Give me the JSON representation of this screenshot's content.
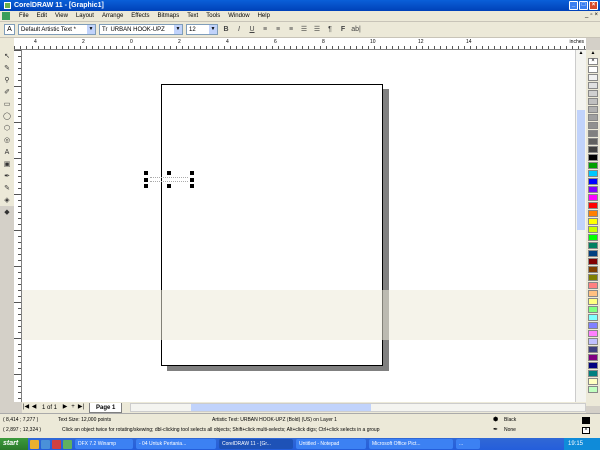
{
  "window": {
    "title": "CorelDRAW 11 - [Graphic1]"
  },
  "menu": [
    "File",
    "Edit",
    "View",
    "Layout",
    "Arrange",
    "Effects",
    "Bitmaps",
    "Text",
    "Tools",
    "Window",
    "Help"
  ],
  "propbar": {
    "style_value": "Default Artistic Text *",
    "font_value": "URBAN HOOK-UPZ",
    "size_value": "12",
    "bold": "B",
    "italic": "I",
    "underline": "U",
    "paragraph": "¶",
    "font_f": "F",
    "abl": "ab|"
  },
  "ruler": {
    "unit": "inches",
    "h_labels": [
      "4",
      "2",
      "0",
      "2",
      "4",
      "6",
      "8",
      "10",
      "12",
      "14"
    ],
    "v_labels": [
      "11",
      "10",
      "9",
      "8",
      "7",
      "6",
      "5",
      "4",
      "3",
      "2",
      "1",
      "0"
    ]
  },
  "pages": {
    "counter": "1 of 1",
    "tab": "Page 1"
  },
  "status": {
    "coords1": "( 8,414 ; 7,277 )",
    "text_size": "Text Size: 12,000 points",
    "object_info": "Artistic Text: URBAN HOOK-UPZ (Bold) (US) on Layer 1",
    "coords2": "( 2,897 ; 12,324 )",
    "hint": "Click an object twice for rotating/skewing; dbl-clicking tool selects all objects; Shift+click multi-selects; Alt+click digs; Ctrl+click selects in a group",
    "fill_label": "Black",
    "outline_label": "None"
  },
  "taskbar": {
    "start": "start",
    "tasks": [
      "DFX 7.2 Winamp",
      "- 04 Untuk Pertania...",
      "CorelDRAW 11 - [Gr...",
      "Untitled - Notepad",
      "Microsoft Office Pict...",
      "..."
    ],
    "time": "19:15"
  },
  "palette_colors": [
    "#ffffff",
    "#f0f0f0",
    "#e0e0e0",
    "#d0d0d0",
    "#c0c0c0",
    "#b0b0b0",
    "#a0a0a0",
    "#909090",
    "#808080",
    "#606060",
    "#404040",
    "#000000",
    "#00a000",
    "#00c8ff",
    "#0000ff",
    "#8000ff",
    "#ff00ff",
    "#ff0000",
    "#ff8000",
    "#ffff00",
    "#c8ff00",
    "#00ff00",
    "#008060",
    "#004080",
    "#800000",
    "#804000",
    "#808000",
    "#ff8080",
    "#ffc080",
    "#ffff80",
    "#80ff80",
    "#80ffff",
    "#8080ff",
    "#ff80ff",
    "#c0c0ff",
    "#404080",
    "#800080",
    "#000080",
    "#008080",
    "#ffffc0",
    "#c0ffc0"
  ]
}
